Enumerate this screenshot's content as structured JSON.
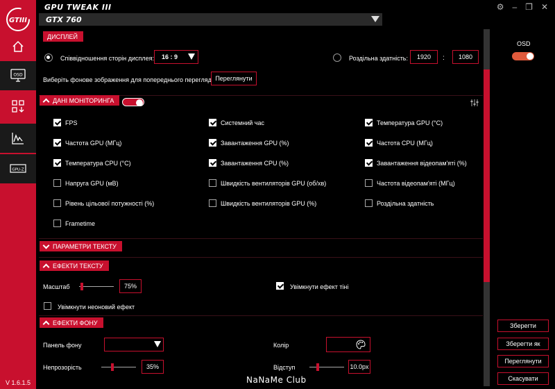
{
  "app": {
    "title": "GPU TWEAK III",
    "version": "V 1.6.1.5",
    "brand": "NaNaMe Club",
    "accent": "#c8102e"
  },
  "header": {
    "gpu": "GTX 760"
  },
  "sidebar": {
    "logo": "GTIII",
    "items": [
      {
        "name": "home-icon"
      },
      {
        "name": "osd-icon",
        "label": "OSD"
      },
      {
        "name": "apps-icon"
      },
      {
        "name": "monitor-icon"
      },
      {
        "name": "gpuz-icon",
        "label": "GPU-Z"
      }
    ]
  },
  "display": {
    "section": "ДИСПЛЕЙ",
    "aspect_label": "Співвідношення сторін дисплея:",
    "aspect_value": "16 : 9",
    "resolution_label": "Роздільна здатність:",
    "res_w": "1920",
    "res_sep": ":",
    "res_h": "1080",
    "bg_label": "Виберіть фонове зображення для попереднього перегляду:",
    "browse": "Переглянути"
  },
  "monitoring": {
    "section": "ДАНІ МОНІТОРИНГА",
    "items": [
      {
        "label": "FPS",
        "checked": true
      },
      {
        "label": "Системний час",
        "checked": true
      },
      {
        "label": "Температура GPU (°C)",
        "checked": true
      },
      {
        "label": "Частота GPU (МГц)",
        "checked": true
      },
      {
        "label": "Завантаження GPU (%)",
        "checked": true
      },
      {
        "label": "Частота CPU (МГц)",
        "checked": true
      },
      {
        "label": "Температура CPU (°C)",
        "checked": true
      },
      {
        "label": "Завантаження CPU (%)",
        "checked": true
      },
      {
        "label": "Завантаження відеопам'яті (%)",
        "checked": true
      },
      {
        "label": "Напруга GPU (мВ)",
        "checked": false
      },
      {
        "label": "Швидкість вентиляторів GPU (об/хв)",
        "checked": false
      },
      {
        "label": "Частота відеопам'яті (МГц)",
        "checked": false
      },
      {
        "label": "Рівень цільової потужності (%)",
        "checked": false
      },
      {
        "label": "Швидкість вентиляторів GPU (%)",
        "checked": false
      },
      {
        "label": "Роздільна здатність",
        "checked": false
      },
      {
        "label": "Frametime",
        "checked": false
      }
    ]
  },
  "text_params": {
    "section": "ПАРАМЕТРИ ТЕКСТУ"
  },
  "text_effects": {
    "section": "ЕФЕКТИ ТЕКСТУ",
    "scale_label": "Масштаб",
    "scale_value": "75%",
    "shadow_label": "Увімкнути ефект тіні",
    "shadow_checked": true,
    "neon_label": "Увімкнути неоновий ефект",
    "neon_checked": false
  },
  "bg_effects": {
    "section": "ЕФЕКТИ ФОНУ",
    "panel_label": "Панель фону",
    "panel_value": "",
    "color_label": "Колір",
    "opacity_label": "Непрозорість",
    "opacity_value": "35%",
    "padding_label": "Відступ",
    "padding_value": "10.0px"
  },
  "right_panel": {
    "osd_label": "OSD",
    "osd_on": true,
    "save": "Зберегти",
    "save_as": "Зберегти як",
    "preview": "Переглянути",
    "cancel": "Скасувати"
  }
}
